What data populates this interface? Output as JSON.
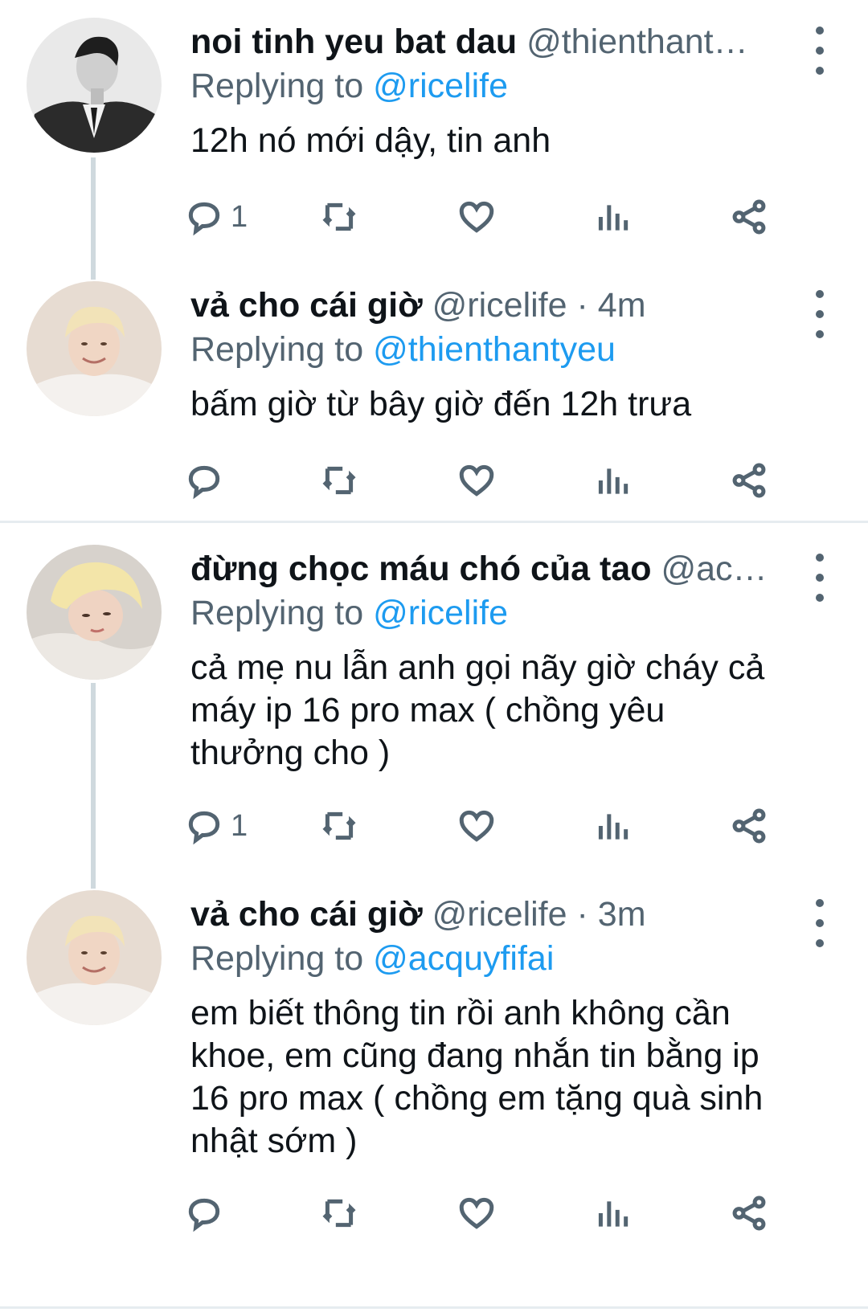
{
  "tweets": [
    {
      "display_name": "noi tinh yeu bat dau",
      "handle": "@thienthant…",
      "time": "",
      "replying_prefix": "Replying to",
      "replying_to": "@ricelife",
      "text": "12h nó mới dậy, tin anh",
      "reply_count": "1",
      "avatar": "avatar-dark-suit"
    },
    {
      "display_name": "vả cho cái giờ",
      "handle": "@ricelife",
      "separator": "·",
      "time": "4m",
      "replying_prefix": "Replying to",
      "replying_to": "@thienthantyeu",
      "text": "bấm giờ từ bây giờ đến 12h trưa",
      "reply_count": "",
      "avatar": "avatar-blonde-smile"
    },
    {
      "display_name": "đừng chọc máu chó của tao",
      "handle": "@ac…",
      "time": "",
      "replying_prefix": "Replying to",
      "replying_to": "@ricelife",
      "text": "cả mẹ nu lẫn anh gọi nãy giờ cháy cả\nmáy ip 16 pro max ( chồng yêu\nthưởng cho )",
      "reply_count": "1",
      "avatar": "avatar-blonde-lying"
    },
    {
      "display_name": "vả cho cái giờ",
      "handle": "@ricelife",
      "separator": "·",
      "time": "3m",
      "replying_prefix": "Replying to",
      "replying_to": "@acquyfifai",
      "text": "em biết thông tin rồi anh không cần\nkhoe, em cũng đang nhắn tin bằng ip\n16 pro max ( chồng em tặng quà sinh\nnhật sớm )",
      "reply_count": "",
      "avatar": "avatar-blonde-smile"
    }
  ],
  "icons": {
    "reply": "reply-icon",
    "retweet": "retweet-icon",
    "like": "like-icon",
    "views": "views-icon",
    "share": "share-icon",
    "more": "more-icon"
  },
  "colors": {
    "link": "#1d9bf0",
    "secondary_text": "#536471",
    "primary_text": "#0f1419",
    "thread_line": "#cfd9de",
    "divider": "#e6ecf0"
  }
}
